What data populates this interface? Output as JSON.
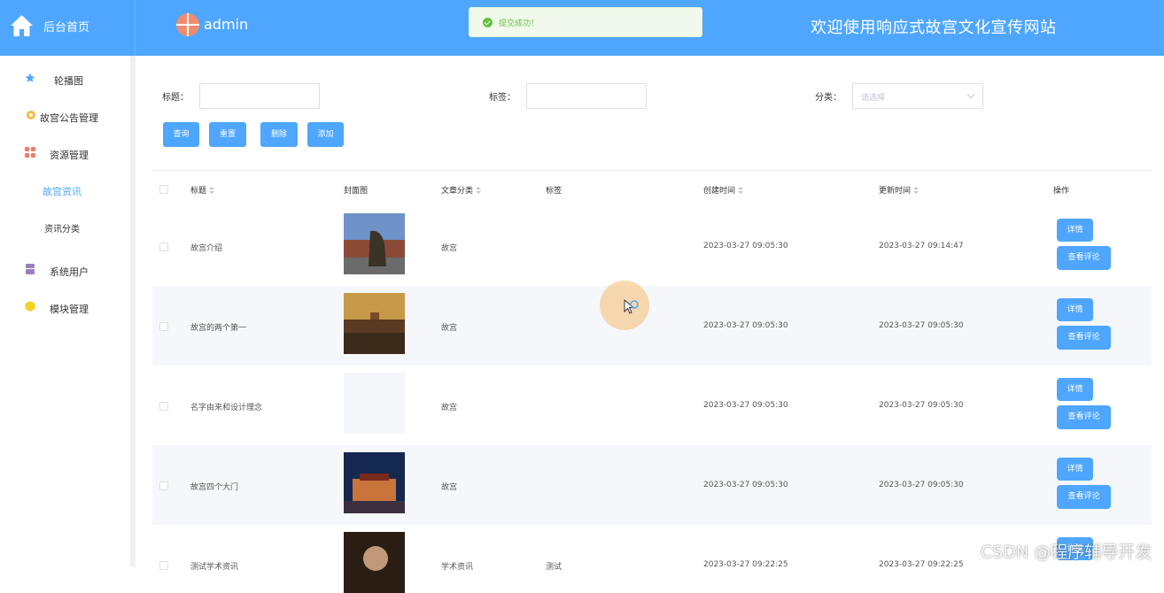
{
  "header": {
    "home_label": "后台首页",
    "username": "admin",
    "site_title": "欢迎使用响应式故宫文化宣传网站",
    "toast": "提交成功！",
    "colors": {
      "primary": "#4ea6ff",
      "success": "#67c23a"
    }
  },
  "sidebar": {
    "items": [
      {
        "label": "轮播图",
        "icon": "star-icon"
      },
      {
        "label": "故宫公告管理",
        "icon": "gear-flower-icon"
      },
      {
        "label": "资源管理",
        "icon": "grid-icon"
      },
      {
        "label": "系统用户",
        "icon": "user-box-icon"
      },
      {
        "label": "模块管理",
        "icon": "cube-icon"
      }
    ],
    "sub_items": [
      {
        "label": "故宫资讯",
        "active": true
      },
      {
        "label": "资讯分类",
        "active": false
      }
    ]
  },
  "filters": {
    "title_label": "标题：",
    "tag_label": "标签",
    "tag_colon": "：",
    "category_label": "分类：",
    "category_placeholder": "请选择"
  },
  "actions": {
    "search": "查询",
    "reset": "重置",
    "delete": "删除",
    "add": "添加"
  },
  "table": {
    "headers": {
      "title": "标题",
      "cover": "封面图",
      "category": "文章分类",
      "tag": "标签",
      "created": "创建时间",
      "updated": "更新时间",
      "ops": "操作"
    },
    "detail_label": "详情",
    "comments_label": "查看评论",
    "rows": [
      {
        "title": "故宫介绍",
        "category": "故宫",
        "tag": "",
        "created": "2023-03-27 09:05:30",
        "updated": "2023-03-27 09:14:47",
        "cover": "lion-statue"
      },
      {
        "title": "故宫的两个第一",
        "category": "故宫",
        "tag": "",
        "created": "2023-03-27 09:05:30",
        "updated": "2023-03-27 09:05:30",
        "cover": "palace-sunset"
      },
      {
        "title": "名字由来和设计理念",
        "category": "故宫",
        "tag": "",
        "created": "2023-03-27 09:05:30",
        "updated": "2023-03-27 09:05:30",
        "cover": "empty"
      },
      {
        "title": "故宫四个大门",
        "category": "故宫",
        "tag": "",
        "created": "2023-03-27 09:05:30",
        "updated": "2023-03-27 09:05:30",
        "cover": "gate-night"
      },
      {
        "title": "测试学术资讯",
        "category": "学术资讯",
        "tag": "测试",
        "created": "2023-03-27 09:22:25",
        "updated": "2023-03-27 09:22:25",
        "cover": "portrait"
      }
    ]
  },
  "watermark": "CSDN @程序辅导开发"
}
